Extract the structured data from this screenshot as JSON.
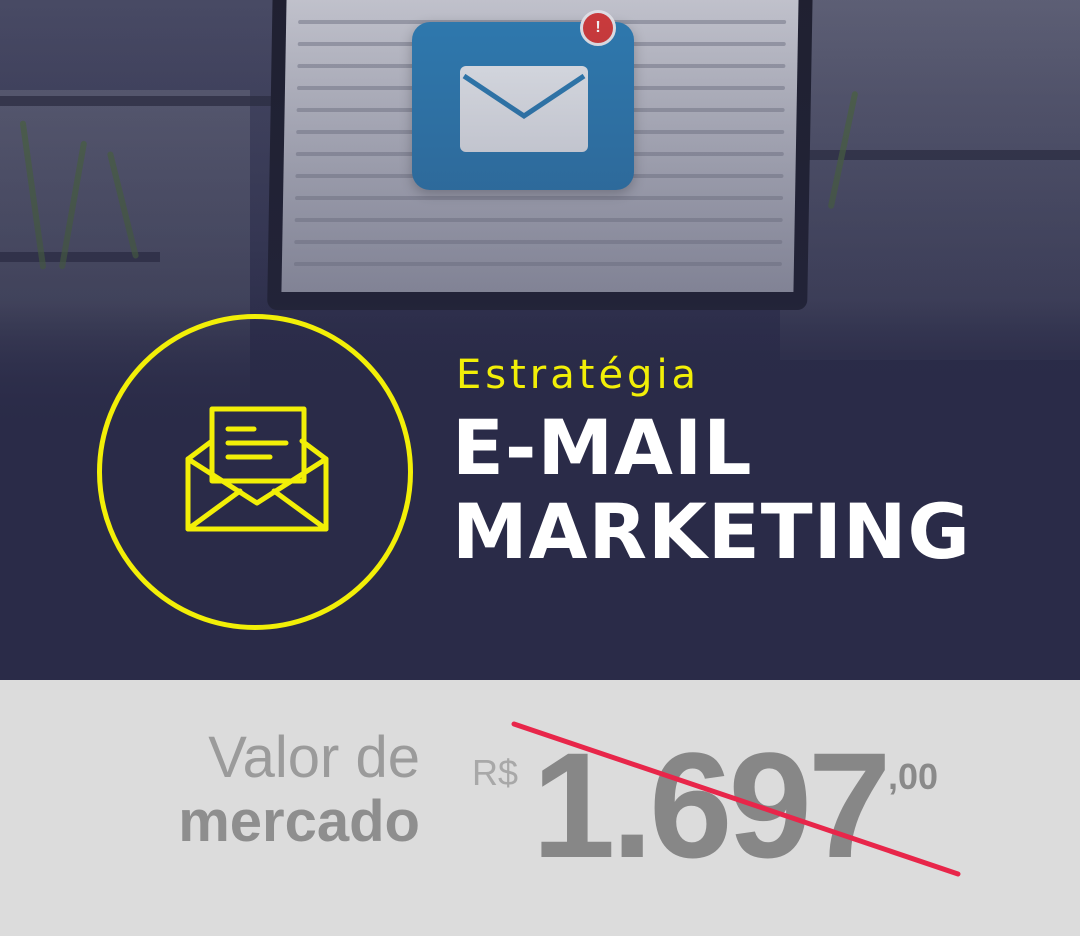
{
  "hero": {
    "eyebrow": "Estratégia",
    "title_line1": "E-MAIL",
    "title_line2": "MARKETING",
    "accent_color": "#f2ef07",
    "background_color": "#2a2b48",
    "badge_alert": "!"
  },
  "icons": {
    "main": "open-envelope-letter-icon",
    "laptop_badge": "envelope-icon"
  },
  "price": {
    "label_line1": "Valor de",
    "label_line2": "mercado",
    "currency": "R$",
    "amount": "1.697",
    "cents": ",00",
    "strike_color": "#e8264a",
    "crossed_out": true
  }
}
